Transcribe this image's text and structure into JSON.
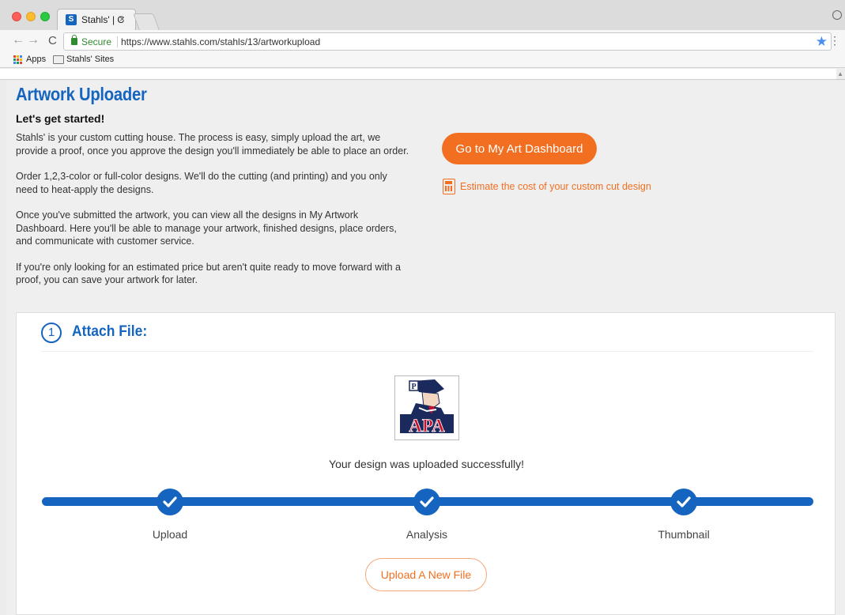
{
  "browser": {
    "tab_title": "Stahls' | C",
    "tab_close": "×",
    "secure_label": "Secure",
    "url": "https://www.stahls.com/stahls/13/artworkupload",
    "bookmarks": [
      {
        "label": "Apps"
      },
      {
        "label": "Stahls' Sites"
      }
    ]
  },
  "page": {
    "title": "Artwork Uploader",
    "subtitle": "Let's get started!",
    "intro": [
      "Stahls' is your custom cutting house. The process is easy, simply upload the art, we provide a proof, once you approve the design you'll immediately be able to place an order.",
      "Order 1,2,3-color or full-color designs. We'll do the cutting (and printing) and you only need to heat-apply the designs.",
      "Once you've submitted the artwork, you can view all the designs in My Artwork Dashboard. Here you'll be able to manage your artwork, finished designs, place orders, and communicate with customer service.",
      "If you're only looking for an estimated price but aren't quite ready to move forward with a proof, you can save your artwork for later."
    ],
    "dashboard_button": "Go to My Art Dashboard",
    "estimate_link": "Estimate the cost of your custom cut design"
  },
  "upload_card": {
    "step_number": "1",
    "step_title": "Attach File:",
    "success_message": "Your design was uploaded successfully!",
    "progress_steps": [
      {
        "label": "Upload",
        "complete": true
      },
      {
        "label": "Analysis",
        "complete": true
      },
      {
        "label": "Thumbnail",
        "complete": true
      }
    ],
    "new_file_button": "Upload A New File",
    "thumbnail_text": "APA"
  },
  "colors": {
    "brand_blue": "#1565c0",
    "accent_orange": "#f26f21"
  }
}
